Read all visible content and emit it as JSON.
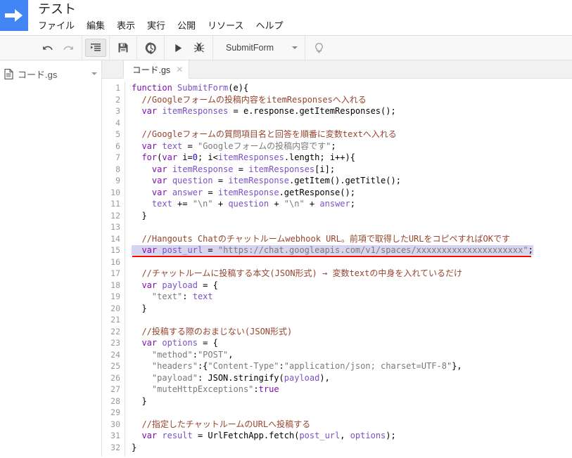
{
  "app": {
    "logo_icon": "apps-script-arrow-icon",
    "title": "テスト"
  },
  "menubar": {
    "items": [
      {
        "label": "ファイル"
      },
      {
        "label": "編集"
      },
      {
        "label": "表示"
      },
      {
        "label": "実行"
      },
      {
        "label": "公開"
      },
      {
        "label": "リソース"
      },
      {
        "label": "ヘルプ"
      }
    ]
  },
  "toolbar": {
    "undo_icon": "undo-icon",
    "redo_icon": "redo-icon",
    "indent_icon": "indent-format-icon",
    "save_icon": "save-floppy-icon",
    "history_icon": "clock-history-icon",
    "run_icon": "run-play-icon",
    "debug_icon": "debug-bug-icon",
    "function_select": "SubmitForm",
    "select_caret_icon": "chevron-down-icon",
    "lightbulb_icon": "lightbulb-icon"
  },
  "sidebar": {
    "file_icon": "file-document-icon",
    "file_name": "コード.gs",
    "file_caret_icon": "chevron-down-icon"
  },
  "tabs": [
    {
      "label": "コード.gs",
      "close_icon": "close-icon"
    }
  ],
  "editor": {
    "first_line": 1,
    "last_line": 32,
    "highlighted_line": 15,
    "selection_color": "#d7d4f0",
    "underline_color": "#ff0000",
    "line_numbers": [
      1,
      2,
      3,
      4,
      5,
      6,
      7,
      8,
      9,
      10,
      11,
      12,
      13,
      14,
      15,
      16,
      17,
      18,
      19,
      20,
      21,
      22,
      23,
      24,
      25,
      26,
      27,
      28,
      29,
      30,
      31,
      32
    ],
    "lines": [
      "function SubmitForm(e){",
      "  //Googleフォームの投稿内容をitemResponsesへ入れる",
      "  var itemResponses = e.response.getItemResponses();",
      "",
      "  //Googleフォームの質問項目名と回答を順番に変数textへ入れる",
      "  var text = \"Googleフォームの投稿内容です\";",
      "  for(var i=0; i<itemResponses.length; i++){",
      "    var itemResponse = itemResponses[i];",
      "    var question = itemResponse.getItem().getTitle();",
      "    var answer = itemResponse.getResponse();",
      "    text += \"\\n\" + question + \"\\n\" + answer;",
      "  }",
      "",
      "  //Hangouts Chatのチャットルームwebhook URL。前項で取得したURLをコピペすればOKです",
      "  var post_url = \"https://chat.googleapis.com/v1/spaces/xxxxxxxxxxxxxxxxxxxxx\";",
      "",
      "  //チャットルームに投稿する本文(JSON形式) → 変数textの中身を入れているだけ",
      "  var payload = {",
      "    \"text\": text",
      "  }",
      "",
      "  //投稿する際のおまじない(JSON形式)",
      "  var options = {",
      "    \"method\":\"POST\",",
      "    \"headers\":{\"Content-Type\":\"application/json; charset=UTF-8\"},",
      "    \"payload\": JSON.stringify(payload),",
      "    \"muteHttpExceptions\":true",
      "  }",
      "",
      "  //指定したチャットルームのURLへ投稿する",
      "  var result = UrlFetchApp.fetch(post_url, options);",
      "}"
    ]
  },
  "colors": {
    "brand_blue": "#4285f4",
    "keyword": "#7f0eb0",
    "comment": "#96442d",
    "string": "#7a7a7a",
    "toolbar_bg": "#f8f8f8",
    "tabstrip_bg": "#f1f1f1"
  }
}
